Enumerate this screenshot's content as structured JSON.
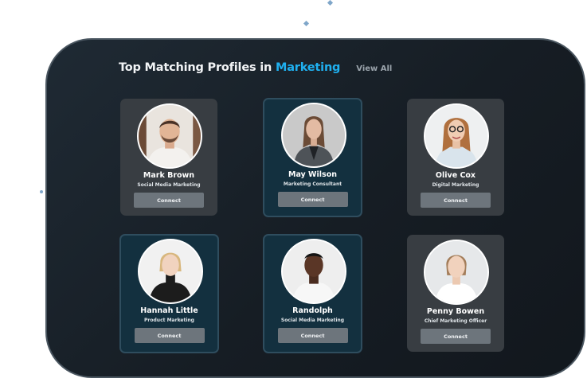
{
  "section": {
    "title_prefix": "Top Matching Profiles in ",
    "title_accent": "Marketing",
    "view_all_label": "View All"
  },
  "colors": {
    "accent": "#1fb0f0",
    "panel": "#161d24",
    "card_gray": "#383d42",
    "card_highlight": "#13303f",
    "button": "#6d757c"
  },
  "profiles": [
    {
      "name": "Mark Brown",
      "role": "Social Media Marketing",
      "button": "Connect",
      "style": "gray"
    },
    {
      "name": "May Wilson",
      "role": "Marketing Consultant",
      "button": "Connect",
      "style": "highlight"
    },
    {
      "name": "Olive Cox",
      "role": "Digital Marketing",
      "button": "Connect",
      "style": "gray"
    },
    {
      "name": "Hannah Little",
      "role": "Product Marketing",
      "button": "Connect",
      "style": "highlight"
    },
    {
      "name": "Randolph",
      "role": "Social Media Marketing",
      "button": "Connect",
      "style": "highlight"
    },
    {
      "name": "Penny Bowen",
      "role": "Chief Marketing Officer",
      "button": "Connect",
      "style": "gray"
    }
  ]
}
